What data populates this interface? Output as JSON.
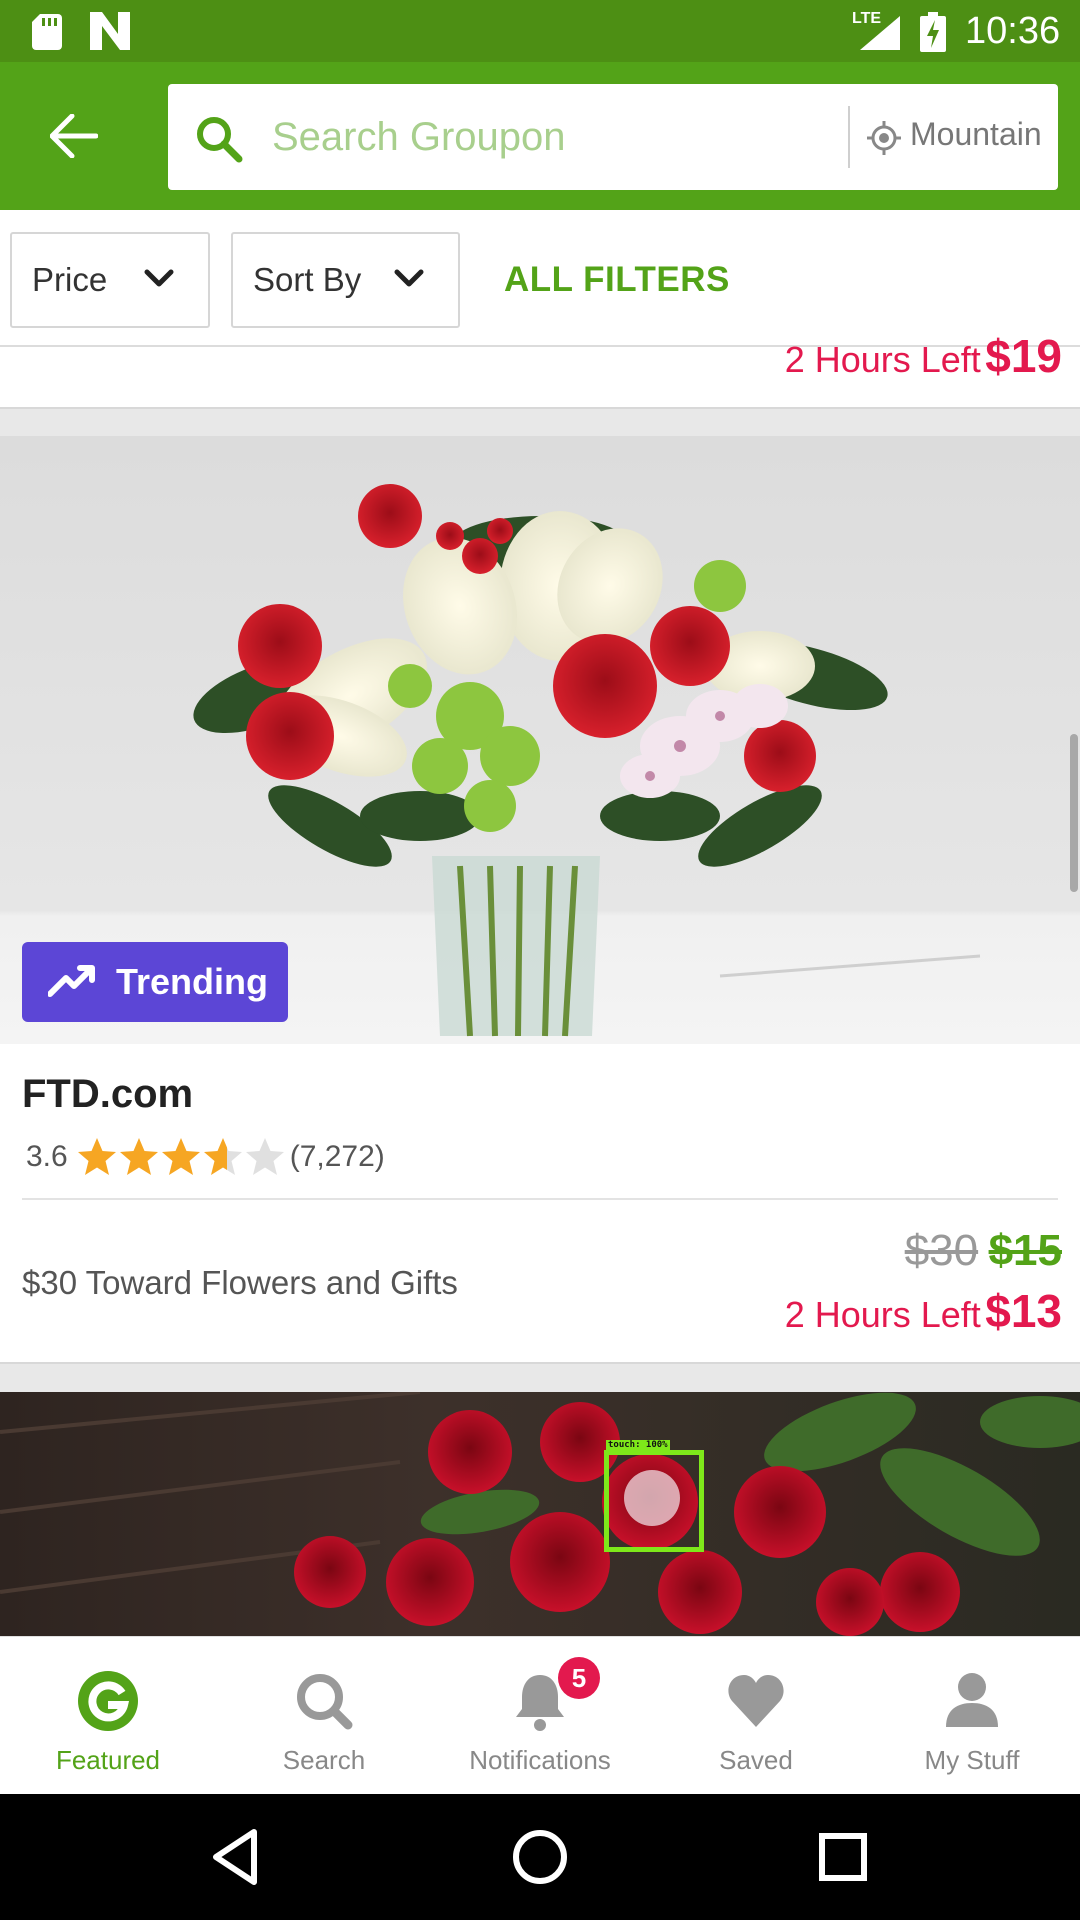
{
  "status_bar": {
    "time": "10:36",
    "network": "LTE"
  },
  "search": {
    "placeholder": "Search Groupon",
    "location": "Mountain"
  },
  "filters": {
    "price_label": "Price",
    "sort_label": "Sort By",
    "all_filters_label": "ALL FILTERS"
  },
  "prev_deal": {
    "time_left_label": "2 Hours Left",
    "time_left_price": "$19"
  },
  "deal": {
    "badge": "Trending",
    "merchant": "FTD.com",
    "rating_value": "3.6",
    "rating_stars": 3.6,
    "review_count": "(7,272)",
    "title": "$30 Toward Flowers and Gifts",
    "original_price": "$30",
    "sale_price": "$15",
    "time_left_label": "2 Hours Left",
    "time_left_price": "$13"
  },
  "touch_indicator": {
    "label": "touch: 100%"
  },
  "nav": {
    "items": [
      {
        "label": "Featured",
        "icon": "groupon-g-icon"
      },
      {
        "label": "Search",
        "icon": "search-icon"
      },
      {
        "label": "Notifications",
        "icon": "bell-icon",
        "badge": "5"
      },
      {
        "label": "Saved",
        "icon": "heart-icon"
      },
      {
        "label": "My Stuff",
        "icon": "person-icon"
      }
    ]
  },
  "colors": {
    "brand_green": "#53a318",
    "status_green": "#4d8f14",
    "deal_red": "#e3194e",
    "trending_purple": "#5c46d6"
  }
}
